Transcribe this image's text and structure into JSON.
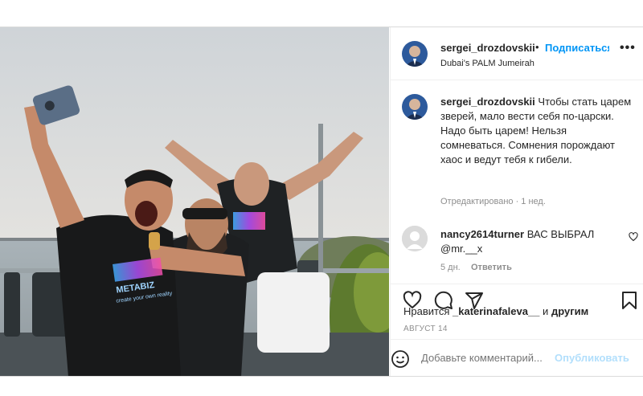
{
  "header": {
    "username": "sergei_drozdovskii",
    "separator": "•",
    "follow_label": "Подписаться",
    "more_label": "•••",
    "location": "Dubai's PALM Jumeirah"
  },
  "caption": {
    "username": "sergei_drozdovskii",
    "text": "Чтобы стать царем зверей, мало вести себя по-царски. Надо быть царем! Нельзя сомневаться. Сомнения порождают хаос и ведут тебя к гибели.",
    "meta": "Отредактировано · 1 нед."
  },
  "comment": {
    "username": "nancy2614turner",
    "text": "ВАС ВЫБРАЛ",
    "mention": "@mr.__x",
    "time": "5 дн.",
    "reply_label": "Ответить",
    "like_icon": "heart-outline-icon"
  },
  "actions": {
    "icons": [
      "heart-icon",
      "comment-icon",
      "share-icon",
      "bookmark-icon"
    ]
  },
  "likes": {
    "prefix": "Нравится",
    "user": "_katerinafaleva__",
    "conj": "и",
    "others": "другим"
  },
  "date": "АВГУСТ 14",
  "add_comment": {
    "placeholder": "Добавьте комментарий...",
    "publish_label": "Опубликовать"
  },
  "photo": {
    "shirt_text": "METABIZ",
    "shirt_subtext": "create your own reality"
  },
  "colors": {
    "accent": "#0095f6",
    "publish_disabled": "#b2dffc",
    "secondary_text": "#8e8e8e"
  }
}
